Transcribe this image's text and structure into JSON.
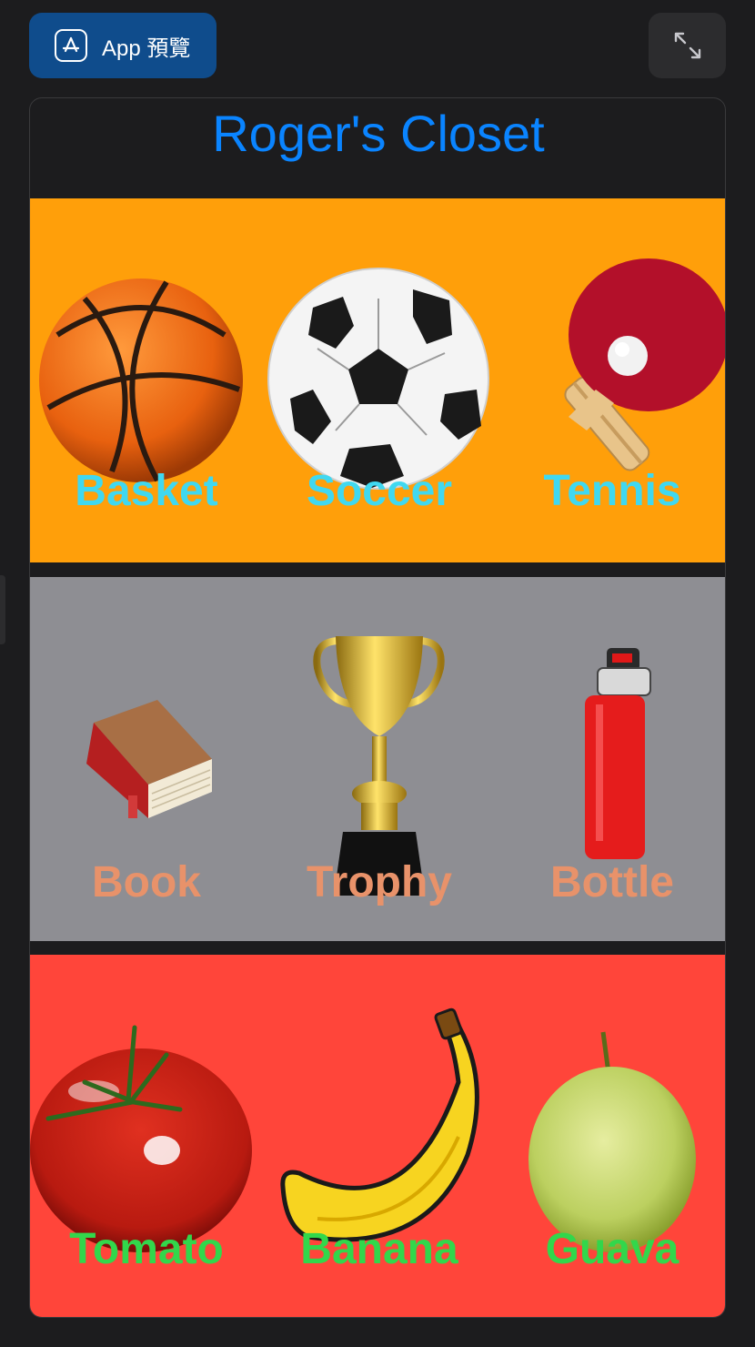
{
  "toolbar": {
    "preview_label": "App 預覽",
    "preview_icon": "app-store-icon",
    "expand_icon": "expand-icon"
  },
  "app": {
    "title": "Roger's Closet",
    "title_color": "#0a84ff"
  },
  "sections": [
    {
      "background": "#ff9f0a",
      "label_color": "#40d8f0",
      "items": [
        {
          "label": "Basket",
          "icon": "basketball-icon"
        },
        {
          "label": "Soccer",
          "icon": "soccer-ball-icon"
        },
        {
          "label": "Tennis",
          "icon": "ping-pong-paddle-icon"
        }
      ]
    },
    {
      "background": "#8e8e93",
      "label_color": "#e8926a",
      "items": [
        {
          "label": "Book",
          "icon": "book-icon"
        },
        {
          "label": "Trophy",
          "icon": "trophy-icon"
        },
        {
          "label": "Bottle",
          "icon": "water-bottle-icon"
        }
      ]
    },
    {
      "background": "#ff453a",
      "label_color": "#32d74b",
      "items": [
        {
          "label": "Tomato",
          "icon": "tomato-icon"
        },
        {
          "label": "Banana",
          "icon": "banana-icon"
        },
        {
          "label": "Guava",
          "icon": "guava-icon"
        }
      ]
    }
  ]
}
